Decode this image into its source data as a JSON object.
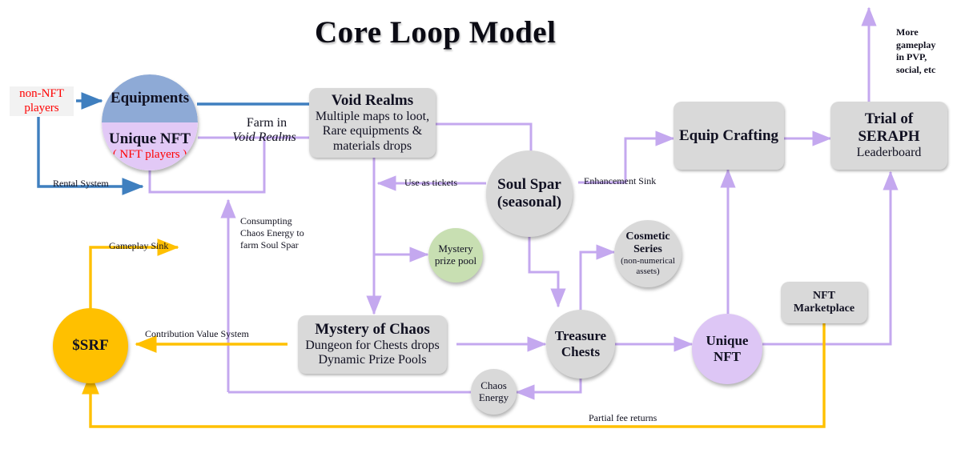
{
  "title": "Core Loop Model",
  "colors": {
    "blue_edge": "#3f7fbf",
    "purple_edge": "#c4a8ef",
    "gold_edge": "#ffc000",
    "node_grey": "#d9d9d9",
    "node_purple": "#ddc6f5",
    "node_green": "#c8dfb2",
    "node_gold": "#ffc000",
    "split_top_blue": "#8eaad6",
    "split_bottom_purple": "#e2c9f6",
    "accent_red": "#ff0000"
  },
  "nodes": {
    "non_nft_players": {
      "label": "non-NFT\nplayers",
      "line1": "non-NFT",
      "line2": "players"
    },
    "player_circle": {
      "top_label": "Equipments",
      "bottom_label": "Unique NFT",
      "bottom_note": "( NFT players )"
    },
    "void_realms": {
      "title": "Void Realms",
      "line1": "Multiple maps to loot,",
      "line2": "Rare equipments &",
      "line3": "materials drops"
    },
    "soul_spar": {
      "line1": "Soul Spar",
      "line2": "(seasonal)"
    },
    "mystery_prize_pool": {
      "line1": "Mystery",
      "line2": "prize pool"
    },
    "mystery_of_chaos": {
      "title": "Mystery of Chaos",
      "line1": "Dungeon for Chests drops",
      "line2": "Dynamic Prize Pools"
    },
    "treasure_chests": {
      "line1": "Treasure",
      "line2": "Chests"
    },
    "chaos_energy": {
      "line1": "Chaos",
      "line2": "Energy"
    },
    "cosmetic_series": {
      "line1": "Cosmetic",
      "line2": "Series",
      "line3": "(non-numerical",
      "line4": "assets)"
    },
    "unique_nft": {
      "label": "Unique NFT"
    },
    "nft_marketplace": {
      "line1": "NFT",
      "line2": "Marketplace"
    },
    "equip_crafting": {
      "label": "Equip Crafting"
    },
    "trial_of_seraph": {
      "line1": "Trial of",
      "line2": "SERAPH",
      "line3": "Leaderboard"
    },
    "srf_token": {
      "label": "$SRF"
    }
  },
  "edge_labels": {
    "rental_system": "Rental System",
    "farm_in": "Farm in",
    "void_realms_italic": "Void Realms",
    "use_as_tickets": "Use as tickets",
    "enhancement_sink": "Enhancement Sink",
    "consuming_chaos": {
      "line1": "Consumpting",
      "line2": "Chaos Energy to",
      "line3": "farm Soul Spar"
    },
    "gameplay_sink": "Gameplay Sink",
    "contribution_value_system": "Contribution Value System",
    "partial_fee_returns": "Partial fee returns",
    "more_gameplay": {
      "line1": "More",
      "line2": "gameplay",
      "line3": "in PVP,",
      "line4": "social, etc"
    }
  }
}
